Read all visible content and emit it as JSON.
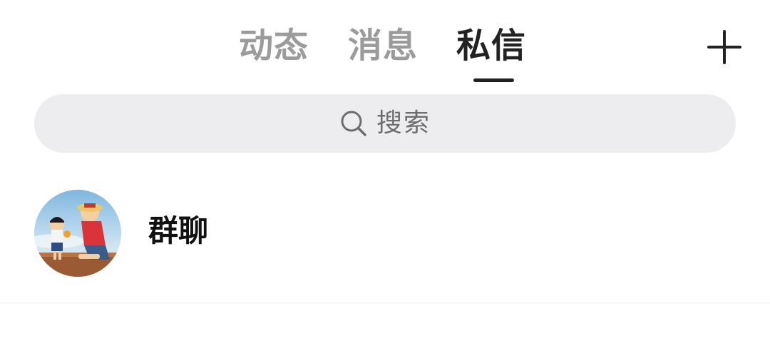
{
  "tabs": [
    {
      "label": "动态",
      "active": false
    },
    {
      "label": "消息",
      "active": false
    },
    {
      "label": "私信",
      "active": true
    }
  ],
  "header": {
    "add_icon": "plus-icon"
  },
  "search": {
    "placeholder": "搜索",
    "icon": "search-icon"
  },
  "chats": [
    {
      "name": "群聊",
      "avatar": "group-avatar"
    }
  ],
  "colors": {
    "active_tab": "#222222",
    "inactive_tab": "#9b9b9b",
    "search_bg": "#ededf0"
  }
}
